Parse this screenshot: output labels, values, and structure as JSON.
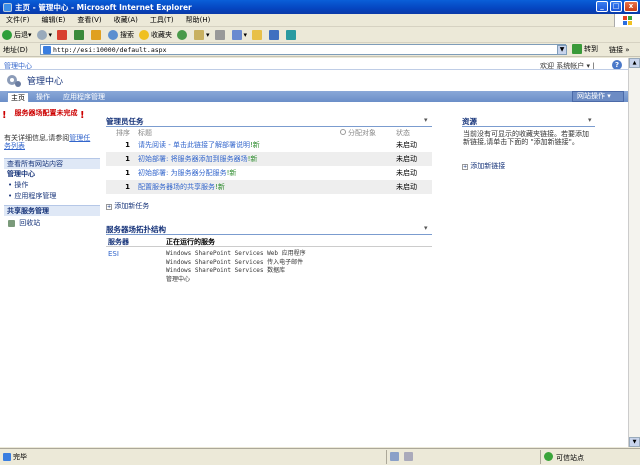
{
  "window": {
    "title": "主页 - 管理中心 - Microsoft Internet Explorer",
    "buttons": [
      "_",
      "□",
      "x"
    ]
  },
  "menu": [
    "文件(F)",
    "编辑(E)",
    "查看(V)",
    "收藏(A)",
    "工具(T)",
    "帮助(H)"
  ],
  "toolbar": {
    "back": "后退",
    "search": "搜索",
    "favorites": "收藏夹"
  },
  "address": {
    "label": "地址(D)",
    "url": "http://esi:10000/default.aspx",
    "go": "转到",
    "links": "链接"
  },
  "page": {
    "breadcrumb": "管理中心",
    "welcome": "欢迎 系统帐户",
    "help": "?",
    "site_title": "管理中心",
    "tabs": [
      "主页",
      "操作",
      "应用程序管理"
    ],
    "site_actions": "网站操作",
    "warning": {
      "title": "服务器场配置未完成",
      "text": "有关详细信息,请参阅",
      "link": "管理任务列表"
    },
    "leftnav": {
      "view_all": "查看所有网站内容",
      "group1": "管理中心",
      "group1_items": [
        "操作",
        "应用程序管理"
      ],
      "group2": "共享服务管理",
      "recycle": "回收站"
    },
    "admin_tasks": {
      "title": "管理员任务",
      "columns": [
        "排序",
        "标题",
        "分配对象",
        "状态"
      ],
      "rows": [
        {
          "order": "1",
          "title": "请先阅读 - 单击此链接了解部署说明",
          "new": "新",
          "status": "未启动"
        },
        {
          "order": "1",
          "title": "初始部署: 将服务器添加到服务器场",
          "new": "新",
          "status": "未启动"
        },
        {
          "order": "1",
          "title": "初始部署: 为服务器分配服务",
          "new": "新",
          "status": "未启动"
        },
        {
          "order": "1",
          "title": "配置服务器场的共享服务",
          "new": "新",
          "status": "未启动"
        }
      ],
      "add": "添加新任务"
    },
    "topology": {
      "title": "服务器场拓扑结构",
      "columns": [
        "服务器",
        "正在运行的服务"
      ],
      "server": "ESI",
      "services": [
        "Windows SharePoint Services Web 应用程序",
        "Windows SharePoint Services 传入电子邮件",
        "Windows SharePoint Services 数据库",
        "管理中心"
      ]
    },
    "resources": {
      "title": "资源",
      "text": "当前没有可显示的收藏夹链接。若要添加新链接,请单击下面的 \"添加新链接\"。",
      "add": "添加新链接"
    }
  },
  "status": {
    "left": "完毕",
    "zone": "可信站点"
  }
}
